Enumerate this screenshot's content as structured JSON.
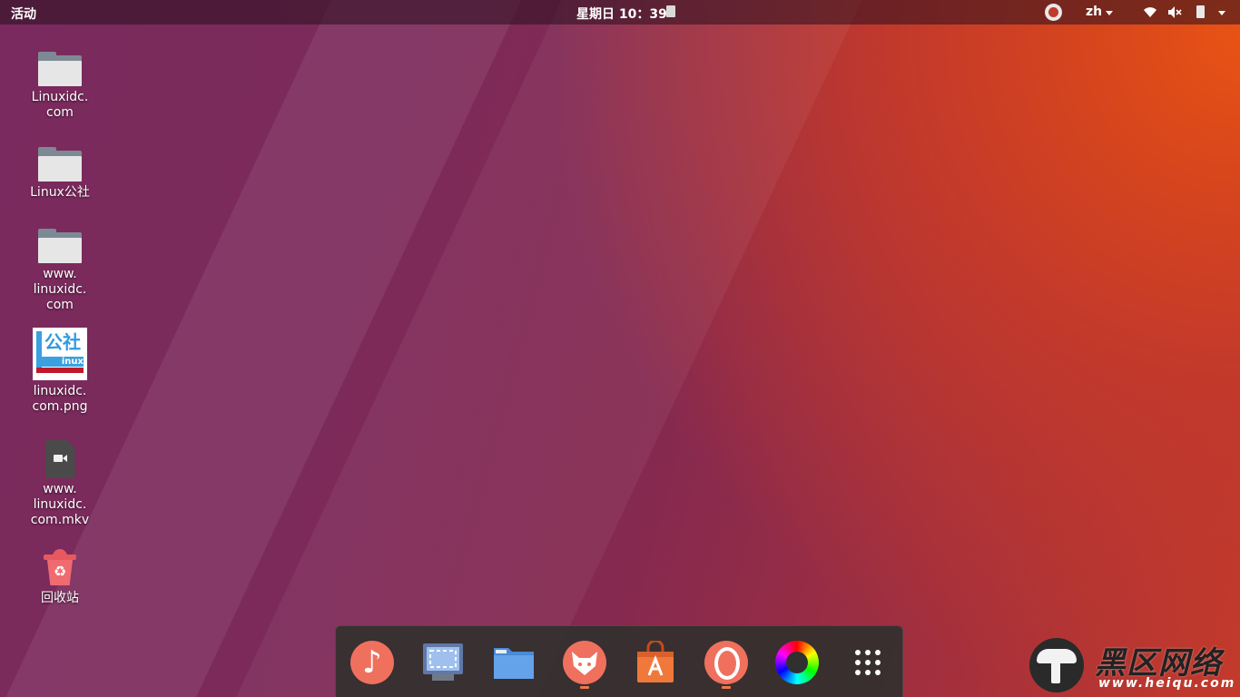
{
  "topbar": {
    "activities_label": "活动",
    "clock_label": "星期日 10：39",
    "language_label": "zh"
  },
  "desktop_items": [
    {
      "label": "Linuxidc.\ncom",
      "type": "folder"
    },
    {
      "label": "Linux公社",
      "type": "folder"
    },
    {
      "label": "www.\nlinuxidc.\ncom",
      "type": "folder"
    },
    {
      "label": "linuxidc.\ncom.png",
      "type": "image",
      "thumbnail_text": "公社",
      "thumbnail_sub": "inux"
    },
    {
      "label": "www.\nlinuxidc.\ncom.mkv",
      "type": "video"
    },
    {
      "label": "回收站",
      "type": "trash"
    }
  ],
  "dock": {
    "apps": [
      {
        "name": "music-player",
        "running": false
      },
      {
        "name": "screenshot",
        "running": false
      },
      {
        "name": "files",
        "running": false
      },
      {
        "name": "firefox",
        "running": true
      },
      {
        "name": "software-center",
        "running": false
      },
      {
        "name": "opera",
        "running": true
      },
      {
        "name": "color-picker",
        "running": false
      },
      {
        "name": "show-applications",
        "running": false
      }
    ]
  },
  "watermark": {
    "title": "黑区网络",
    "url": "www.heiqu.com"
  },
  "colors": {
    "accent_orange": "#e95420",
    "aubergine": "#772953",
    "running_indicator": "#f07746"
  }
}
